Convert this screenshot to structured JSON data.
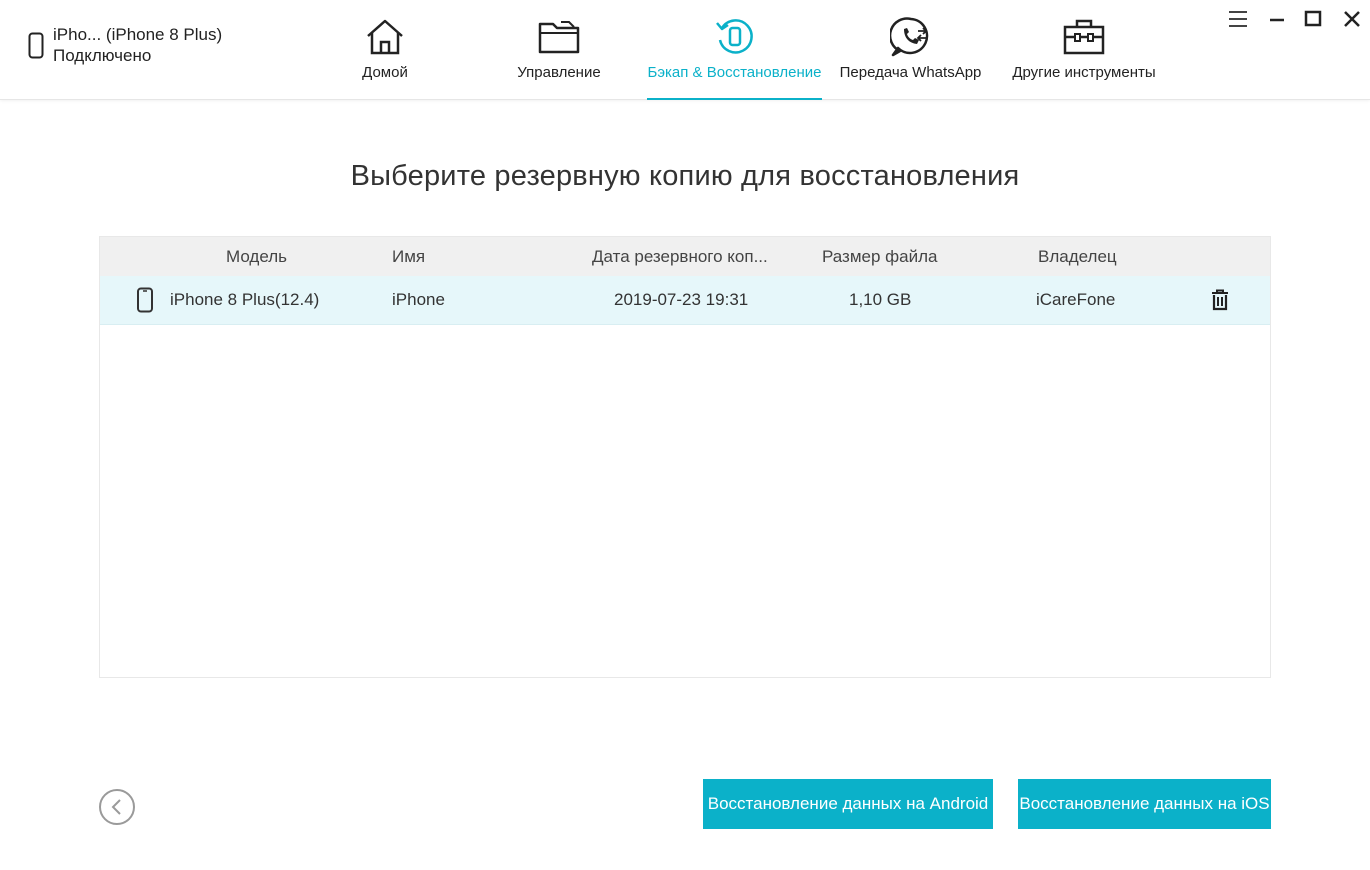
{
  "device": {
    "name": "iPho... (iPhone 8 Plus)",
    "status": "Подключено",
    "icon": "phone-icon"
  },
  "tabs": [
    {
      "label": "Домой",
      "icon": "home-icon",
      "active": false
    },
    {
      "label": "Управление",
      "icon": "folder-icon",
      "active": false
    },
    {
      "label": "Бэкап & Восстановление",
      "icon": "backup-restore-icon",
      "active": true
    },
    {
      "label": "Передача WhatsApp",
      "icon": "whatsapp-icon",
      "active": false
    },
    {
      "label": "Другие инструменты",
      "icon": "toolbox-icon",
      "active": false
    }
  ],
  "window_controls": [
    "menu-icon",
    "minimize-icon",
    "maximize-icon",
    "close-icon"
  ],
  "heading": "Выберите резервную копию для восстановления",
  "table": {
    "columns": [
      "Модель",
      "Имя",
      "Дата резервного коп...",
      "Размер файла",
      "Владелец"
    ],
    "rows": [
      {
        "model": "iPhone 8 Plus(12.4)",
        "name": "iPhone",
        "date": "2019-07-23 19:31",
        "size": "1,10 GB",
        "owner": "iCareFone"
      }
    ]
  },
  "buttons": {
    "restore_android": "Восстановление данных на Android",
    "restore_ios": "Восстановление данных на iOS"
  },
  "colors": {
    "accent": "#0bb1c9",
    "row_highlight": "#e6f7fa",
    "header_bg": "#f0f0f0"
  }
}
